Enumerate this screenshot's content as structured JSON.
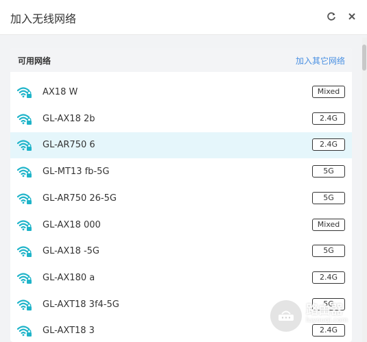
{
  "dialog": {
    "title": "加入无线网络",
    "refresh_icon": "refresh-icon",
    "close_icon": "close-icon"
  },
  "panel": {
    "title": "可用网络",
    "other_link": "加入其它网络"
  },
  "networks": [
    {
      "ssid": "AX18     W",
      "band": "Mixed"
    },
    {
      "ssid": "GL-AX18     2b",
      "band": "2.4G"
    },
    {
      "ssid": "GL-AR750     6",
      "band": "2.4G",
      "selected": true
    },
    {
      "ssid": "GL-MT13     fb-5G",
      "band": "5G"
    },
    {
      "ssid": "GL-AR750     26-5G",
      "band": "5G"
    },
    {
      "ssid": "GL-AX18     000",
      "band": "Mixed"
    },
    {
      "ssid": "GL-AX18          -5G",
      "band": "5G"
    },
    {
      "ssid": "GL-AX180     a",
      "band": "2.4G"
    },
    {
      "ssid": "GL-AXT18     3f4-5G",
      "band": "5G"
    },
    {
      "ssid": "GL-AXT18     3",
      "band": "2.4G"
    }
  ],
  "colors": {
    "wifi": "#1fb4c9",
    "link": "#4a90e2",
    "selected_row": "#e5f6fb"
  },
  "watermark": {
    "text": "路由器",
    "sub": "luyouqi.com"
  }
}
